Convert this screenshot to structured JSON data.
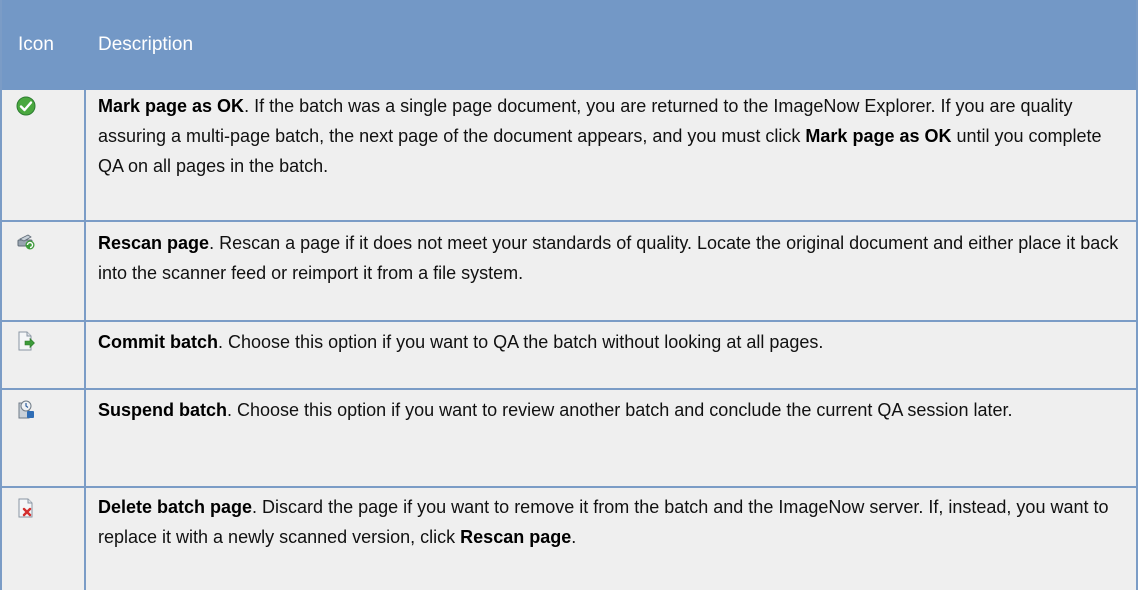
{
  "header": {
    "icon": "Icon",
    "description": "Description"
  },
  "rows": [
    {
      "icon": "check-icon",
      "title": "Mark page as OK",
      "parts": [
        ". If the batch was a single page document, you are returned to the ImageNow Explorer. If you are quality assuring a multi-page batch, the next page of the document appears, and you must click ",
        "Mark page as OK",
        " until you complete QA on all pages in the batch."
      ]
    },
    {
      "icon": "rescan-icon",
      "title": "Rescan page",
      "text": ". Rescan a page if it does not meet your standards of quality. Locate the original document and either place it back into the scanner feed or reimport it from a file system."
    },
    {
      "icon": "commit-icon",
      "title": "Commit batch",
      "text": ". Choose this option if you want to QA the batch without looking at all pages."
    },
    {
      "icon": "suspend-icon",
      "title": "Suspend batch",
      "text": ". Choose this option if you want to review another batch and conclude the current QA session later."
    },
    {
      "icon": "delete-page-icon",
      "title": "Delete batch page",
      "parts": [
        ". Discard the page if you want to remove it from the batch and the ImageNow server. If, instead, you want to replace it with a newly scanned version, click ",
        "Rescan page",
        "."
      ]
    }
  ],
  "colors": {
    "header_bg": "#7398c6",
    "row_bg": "#efefef",
    "border": "#7b9cc6"
  }
}
